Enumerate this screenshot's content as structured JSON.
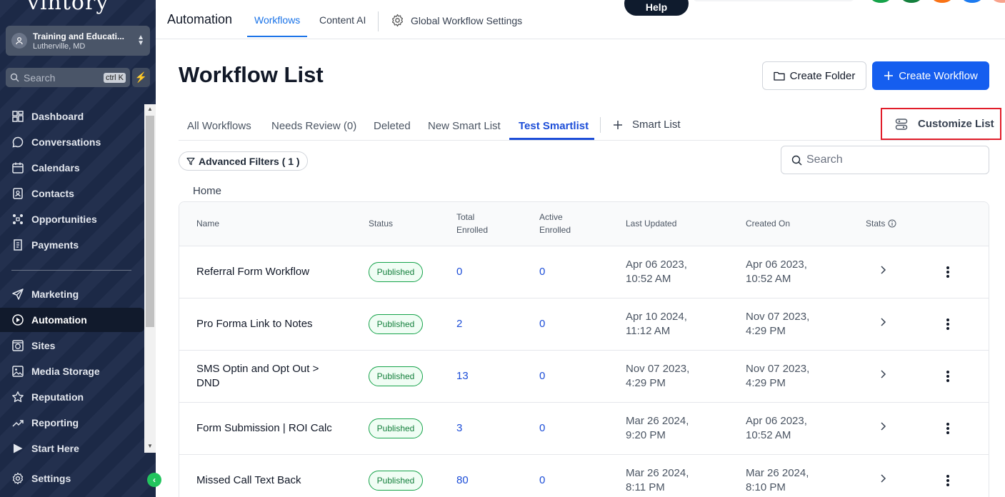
{
  "sidebar": {
    "logo": "vintory",
    "account": {
      "name": "Training and Educati...",
      "location": "Lutherville, MD"
    },
    "search": {
      "placeholder": "Search",
      "shortcut": "ctrl K"
    },
    "items": [
      {
        "label": "Dashboard",
        "icon": "dashboard-icon"
      },
      {
        "label": "Conversations",
        "icon": "chat-bubble-icon"
      },
      {
        "label": "Calendars",
        "icon": "calendar-icon"
      },
      {
        "label": "Contacts",
        "icon": "contacts-icon"
      },
      {
        "label": "Opportunities",
        "icon": "pipeline-icon"
      },
      {
        "label": "Payments",
        "icon": "receipt-icon"
      },
      {
        "label": "Marketing",
        "icon": "send-icon"
      },
      {
        "label": "Automation",
        "icon": "automation-icon",
        "active": true
      },
      {
        "label": "Sites",
        "icon": "globe-icon"
      },
      {
        "label": "Media Storage",
        "icon": "image-icon"
      },
      {
        "label": "Reputation",
        "icon": "star-icon"
      },
      {
        "label": "Reporting",
        "icon": "trend-icon"
      },
      {
        "label": "Start Here",
        "icon": "play-icon"
      },
      {
        "label": "Settings",
        "icon": "gear-icon"
      }
    ]
  },
  "topbar": {
    "title": "Automation",
    "tabs": [
      "Workflows",
      "Content AI"
    ],
    "settings_label": "Global Workflow Settings",
    "help_label": "Help"
  },
  "main": {
    "title": "Workflow List",
    "create_folder": "Create Folder",
    "create_workflow": "Create Workflow",
    "tabs": [
      "All Workflows",
      "Needs Review (0)",
      "Deleted",
      "New Smart List",
      "Test Smartlist"
    ],
    "add_smart_list": "Smart List",
    "customize_list": "Customize List",
    "advanced_filters": "Advanced Filters ( 1 )",
    "search_placeholder": "Search",
    "breadcrumb": "Home"
  },
  "table": {
    "headers": {
      "name": "Name",
      "status": "Status",
      "total_1": "Total",
      "total_2": "Enrolled",
      "active_1": "Active",
      "active_2": "Enrolled",
      "last_updated": "Last Updated",
      "created_on": "Created On",
      "stats": "Stats"
    },
    "rows": [
      {
        "name_1": "Referral Form Workflow",
        "name_2": "",
        "status": "Published",
        "total": "0",
        "active": "0",
        "updated_1": "Apr 06 2023,",
        "updated_2": "10:52 AM",
        "created_1": "Apr 06 2023,",
        "created_2": "10:52 AM"
      },
      {
        "name_1": "Pro Forma Link to Notes",
        "name_2": "",
        "status": "Published",
        "total": "2",
        "active": "0",
        "updated_1": "Apr 10 2024,",
        "updated_2": "11:12 AM",
        "created_1": "Nov 07 2023,",
        "created_2": "4:29 PM"
      },
      {
        "name_1": "SMS Optin and Opt Out >",
        "name_2": "DND",
        "status": "Published",
        "total": "13",
        "active": "0",
        "updated_1": "Nov 07 2023,",
        "updated_2": "4:29 PM",
        "created_1": "Nov 07 2023,",
        "created_2": "4:29 PM"
      },
      {
        "name_1": "Form Submission | ROI Calc",
        "name_2": "",
        "status": "Published",
        "total": "3",
        "active": "0",
        "updated_1": "Mar 26 2024,",
        "updated_2": "9:20 PM",
        "created_1": "Apr 06 2023,",
        "created_2": "10:52 AM"
      },
      {
        "name_1": "Missed Call Text Back",
        "name_2": "",
        "status": "Published",
        "total": "80",
        "active": "0",
        "updated_1": "Mar 26 2024,",
        "updated_2": "8:11 PM",
        "created_1": "Mar 26 2024,",
        "created_2": "8:10 PM"
      }
    ]
  },
  "colors": {
    "accent": "#155eef",
    "sidebar": "#1e2b4a",
    "published": "#16a34a",
    "highlight": "#e11d2a"
  }
}
